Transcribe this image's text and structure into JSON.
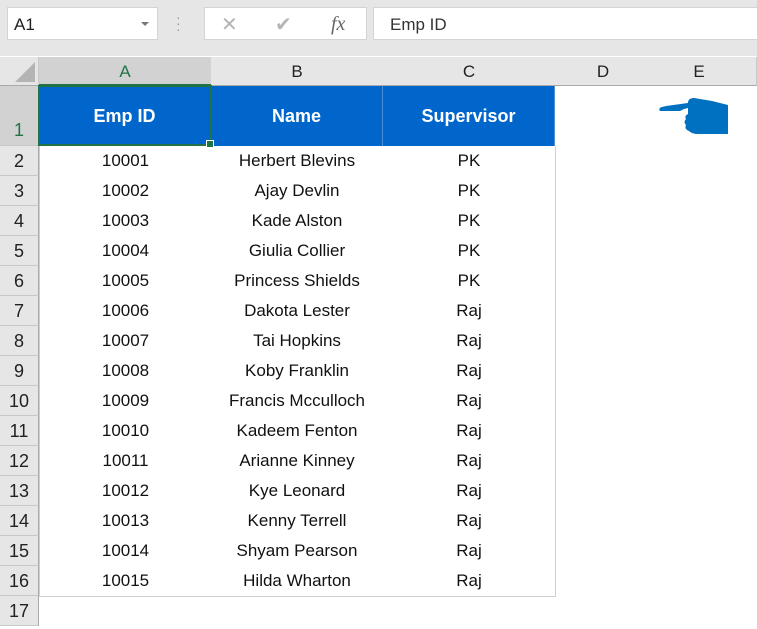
{
  "name_box": {
    "value": "A1"
  },
  "formula_bar": {
    "cancel_icon": "close-icon",
    "enter_icon": "check-icon",
    "function_label": "fx",
    "value": "Emp ID"
  },
  "columns": [
    "A",
    "B",
    "C",
    "D",
    "E"
  ],
  "rows": [
    "1",
    "2",
    "3",
    "4",
    "5",
    "6",
    "7",
    "8",
    "9",
    "10",
    "11",
    "12",
    "13",
    "14",
    "15",
    "16",
    "17"
  ],
  "table": {
    "headers": [
      "Emp ID",
      "Name",
      "Supervisor"
    ],
    "header_color": "#0066cc",
    "records": [
      [
        "10001",
        "Herbert Blevins",
        "PK"
      ],
      [
        "10002",
        "Ajay Devlin",
        "PK"
      ],
      [
        "10003",
        "Kade Alston",
        "PK"
      ],
      [
        "10004",
        "Giulia Collier",
        "PK"
      ],
      [
        "10005",
        "Princess Shields",
        "PK"
      ],
      [
        "10006",
        "Dakota Lester",
        "Raj"
      ],
      [
        "10007",
        "Tai Hopkins",
        "Raj"
      ],
      [
        "10008",
        "Koby Franklin",
        "Raj"
      ],
      [
        "10009",
        "Francis Mcculloch",
        "Raj"
      ],
      [
        "10010",
        "Kadeem Fenton",
        "Raj"
      ],
      [
        "10011",
        "Arianne Kinney",
        "Raj"
      ],
      [
        "10012",
        "Kye Leonard",
        "Raj"
      ],
      [
        "10013",
        "Kenny Terrell",
        "Raj"
      ],
      [
        "10014",
        "Shyam Pearson",
        "Raj"
      ],
      [
        "10015",
        "Hilda Wharton",
        "Raj"
      ]
    ]
  },
  "selected_cell": "A1",
  "annotation": {
    "icon": "pointing-hand-left-icon",
    "color": "#0070c0"
  }
}
